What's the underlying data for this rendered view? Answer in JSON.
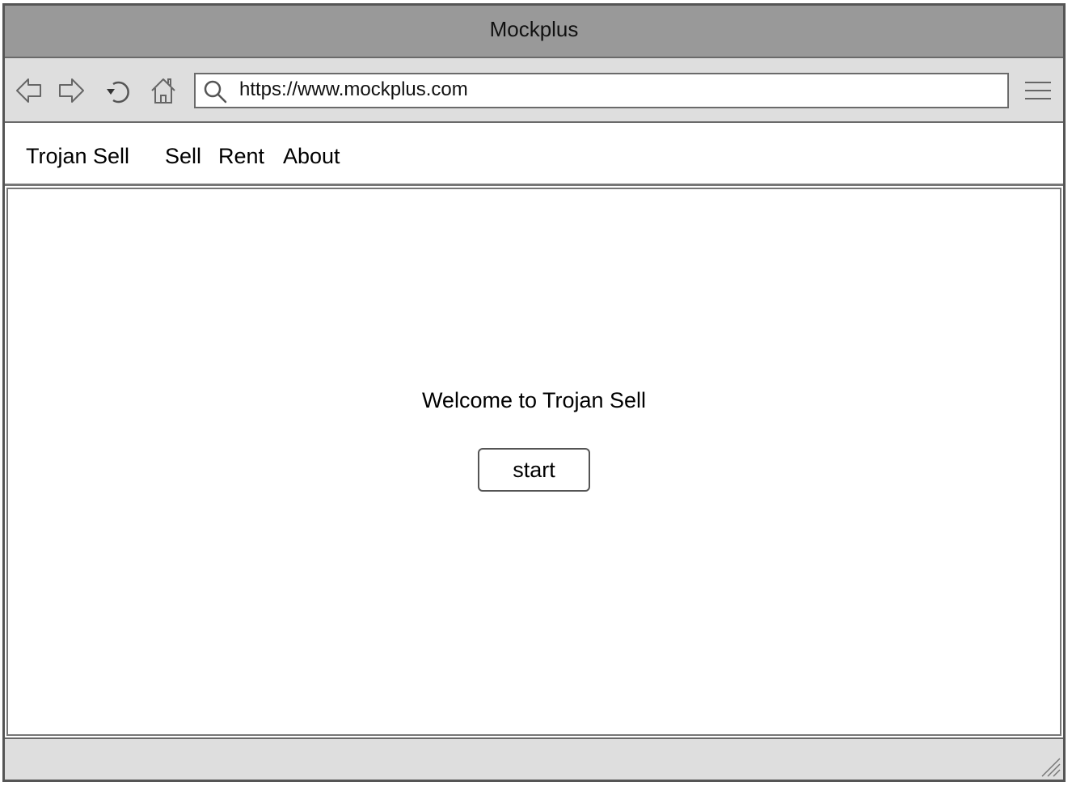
{
  "window": {
    "title": "Mockplus"
  },
  "toolbar": {
    "back_icon": "arrow-left-icon",
    "forward_icon": "arrow-right-icon",
    "reload_icon": "reload-icon",
    "home_icon": "home-icon",
    "search_icon": "search-icon",
    "url": "https://www.mockplus.com",
    "menu_icon": "hamburger-menu-icon"
  },
  "navbar": {
    "brand": "Trojan Sell",
    "links": [
      {
        "label": "Sell"
      },
      {
        "label": "Rent"
      },
      {
        "label": "About"
      }
    ]
  },
  "main": {
    "welcome_text": "Welcome to Trojan Sell",
    "start_label": "start"
  },
  "colors": {
    "titlebar_bg": "#999999",
    "toolbar_bg": "#dedede",
    "border": "#555555",
    "content_bg": "#ffffff"
  }
}
